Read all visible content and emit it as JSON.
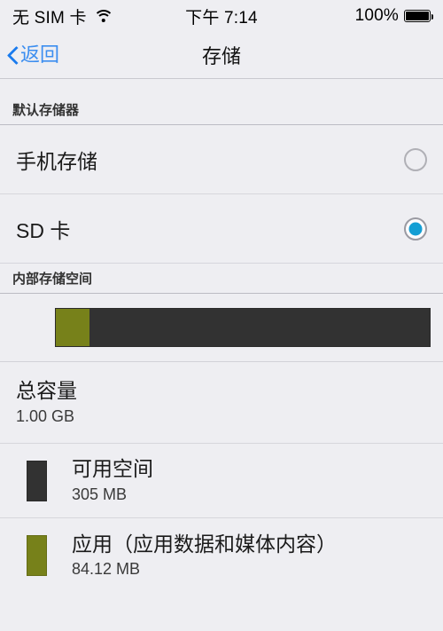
{
  "status_bar": {
    "carrier": "无 SIM 卡",
    "wifi_icon": "wifi-icon",
    "time": "下午 7:14",
    "battery_percent": "100%",
    "battery_icon": "battery-full-icon"
  },
  "nav": {
    "back_label": "返回",
    "back_icon": "chevron-left-icon",
    "title": "存储"
  },
  "sections": {
    "default_storage": {
      "header": "默认存储器",
      "options": [
        {
          "label": "手机存储",
          "selected": false
        },
        {
          "label": "SD 卡",
          "selected": true
        }
      ]
    },
    "internal_storage": {
      "header": "内部存储空间"
    }
  },
  "capacity": {
    "total_label": "总容量",
    "total_value": "1.00 GB",
    "items": [
      {
        "label": "可用空间",
        "value": "305 MB",
        "color": "#323232"
      },
      {
        "label": "应用（应用数据和媒体内容）",
        "value": "84.12 MB",
        "color": "#77811a"
      }
    ]
  },
  "chart_data": {
    "type": "bar",
    "title": "内部存储空间",
    "orientation": "horizontal-stacked",
    "total_label": "总容量",
    "total": "1.00 GB",
    "total_mb": 1024,
    "categories": [
      "应用（应用数据和媒体内容）",
      "可用空间"
    ],
    "values": [
      84.12,
      305
    ],
    "units": "MB",
    "colors": [
      "#77811a",
      "#323232"
    ],
    "segments": [
      {
        "name": "应用（应用数据和媒体内容）",
        "value": 84.12,
        "units": "MB",
        "color": "#77811a",
        "width_pct": 9
      },
      {
        "name": "可用空间",
        "value": 305,
        "units": "MB",
        "color": "#323232",
        "width_pct": 91
      }
    ],
    "legend": [
      "可用空间",
      "应用（应用数据和媒体内容）"
    ],
    "grid": false
  },
  "colors": {
    "background": "#eeeef2",
    "accent_blue": "#3c8ef0",
    "radio_blue": "#139ed4",
    "olive": "#77811a",
    "dark_gray": "#323232"
  }
}
